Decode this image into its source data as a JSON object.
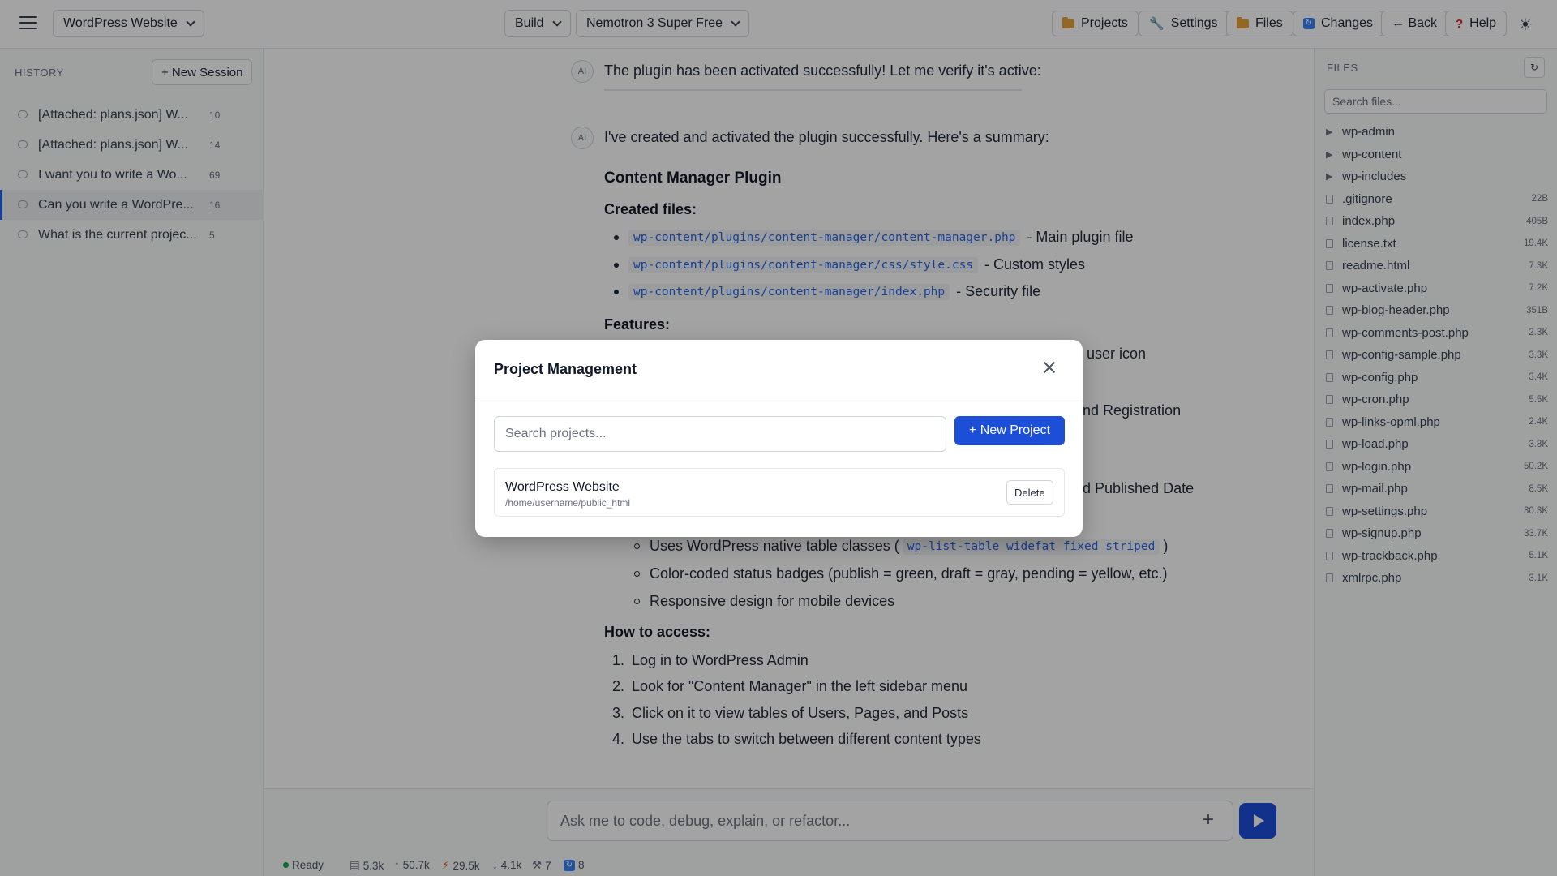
{
  "topbar": {
    "project": "WordPress Website",
    "mode": "Build",
    "model": "Nemotron 3 Super Free",
    "projects": "Projects",
    "settings": "Settings",
    "files": "Files",
    "changes": "Changes",
    "back": "← Back",
    "help": "Help"
  },
  "sidebar": {
    "label": "HISTORY",
    "new_session": "+ New Session",
    "items": [
      {
        "text": "[Attached: plans.json] W...",
        "count": "10"
      },
      {
        "text": "[Attached: plans.json] W...",
        "count": "14"
      },
      {
        "text": "I want you to write a Wo...",
        "count": "69"
      },
      {
        "text": "Can you write a WordPre...",
        "count": "16"
      },
      {
        "text": "What is the current projec...",
        "count": "5"
      }
    ]
  },
  "chat": {
    "ai_label": "AI",
    "msg1": "The plugin has been activated successfully! Let me verify it's active:",
    "msg2": "I've created and activated the plugin successfully. Here's a summary:",
    "heading": "Content Manager Plugin",
    "created_label": "Created files:",
    "files": [
      {
        "path": "wp-content/plugins/content-manager/content-manager.php",
        "desc": "- Main plugin file"
      },
      {
        "path": "wp-content/plugins/content-manager/css/style.css",
        "desc": "- Custom styles"
      },
      {
        "path": "wp-content/plugins/content-manager/index.php",
        "desc": "- Security file"
      }
    ],
    "features_label": "Features:",
    "frag1": "a user icon",
    "frag2": "and Registration",
    "frag3": "nd Published Date",
    "sub1_pre": "Uses WordPress native table classes (",
    "sub1_code": "wp-list-table widefat fixed striped",
    "sub1_post": ")",
    "sub2": "Color-coded status badges (publish = green, draft = gray, pending = yellow, etc.)",
    "sub3": "Responsive design for mobile devices",
    "access_label": "How to access:",
    "steps": [
      "Log in to WordPress Admin",
      "Look for \"Content Manager\" in the left sidebar menu",
      "Click on it to view tables of Users, Pages, and Posts",
      "Use the tabs to switch between different content types"
    ],
    "step_nums": [
      "1.",
      "2.",
      "3.",
      "4."
    ]
  },
  "input": {
    "placeholder": "Ask me to code, debug, explain, or refactor..."
  },
  "status": {
    "state": "Ready",
    "s1": "5.3k",
    "s2": "50.7k",
    "s3": "29.5k",
    "s4": "4.1k",
    "s5": "7",
    "s6": "8"
  },
  "files_panel": {
    "label": "FILES",
    "search_placeholder": "Search files...",
    "folders": [
      "wp-admin",
      "wp-content",
      "wp-includes"
    ],
    "files": [
      {
        "name": ".gitignore",
        "size": "22B"
      },
      {
        "name": "index.php",
        "size": "405B"
      },
      {
        "name": "license.txt",
        "size": "19.4K"
      },
      {
        "name": "readme.html",
        "size": "7.3K"
      },
      {
        "name": "wp-activate.php",
        "size": "7.2K"
      },
      {
        "name": "wp-blog-header.php",
        "size": "351B"
      },
      {
        "name": "wp-comments-post.php",
        "size": "2.3K"
      },
      {
        "name": "wp-config-sample.php",
        "size": "3.3K"
      },
      {
        "name": "wp-config.php",
        "size": "3.4K"
      },
      {
        "name": "wp-cron.php",
        "size": "5.5K"
      },
      {
        "name": "wp-links-opml.php",
        "size": "2.4K"
      },
      {
        "name": "wp-load.php",
        "size": "3.8K"
      },
      {
        "name": "wp-login.php",
        "size": "50.2K"
      },
      {
        "name": "wp-mail.php",
        "size": "8.5K"
      },
      {
        "name": "wp-settings.php",
        "size": "30.3K"
      },
      {
        "name": "wp-signup.php",
        "size": "33.7K"
      },
      {
        "name": "wp-trackback.php",
        "size": "5.1K"
      },
      {
        "name": "xmlrpc.php",
        "size": "3.1K"
      }
    ]
  },
  "modal": {
    "title": "Project Management",
    "search_placeholder": "Search projects...",
    "new_project": "+ New Project",
    "project_name": "WordPress Website",
    "project_path": "/home/username/public_html",
    "delete": "Delete"
  }
}
